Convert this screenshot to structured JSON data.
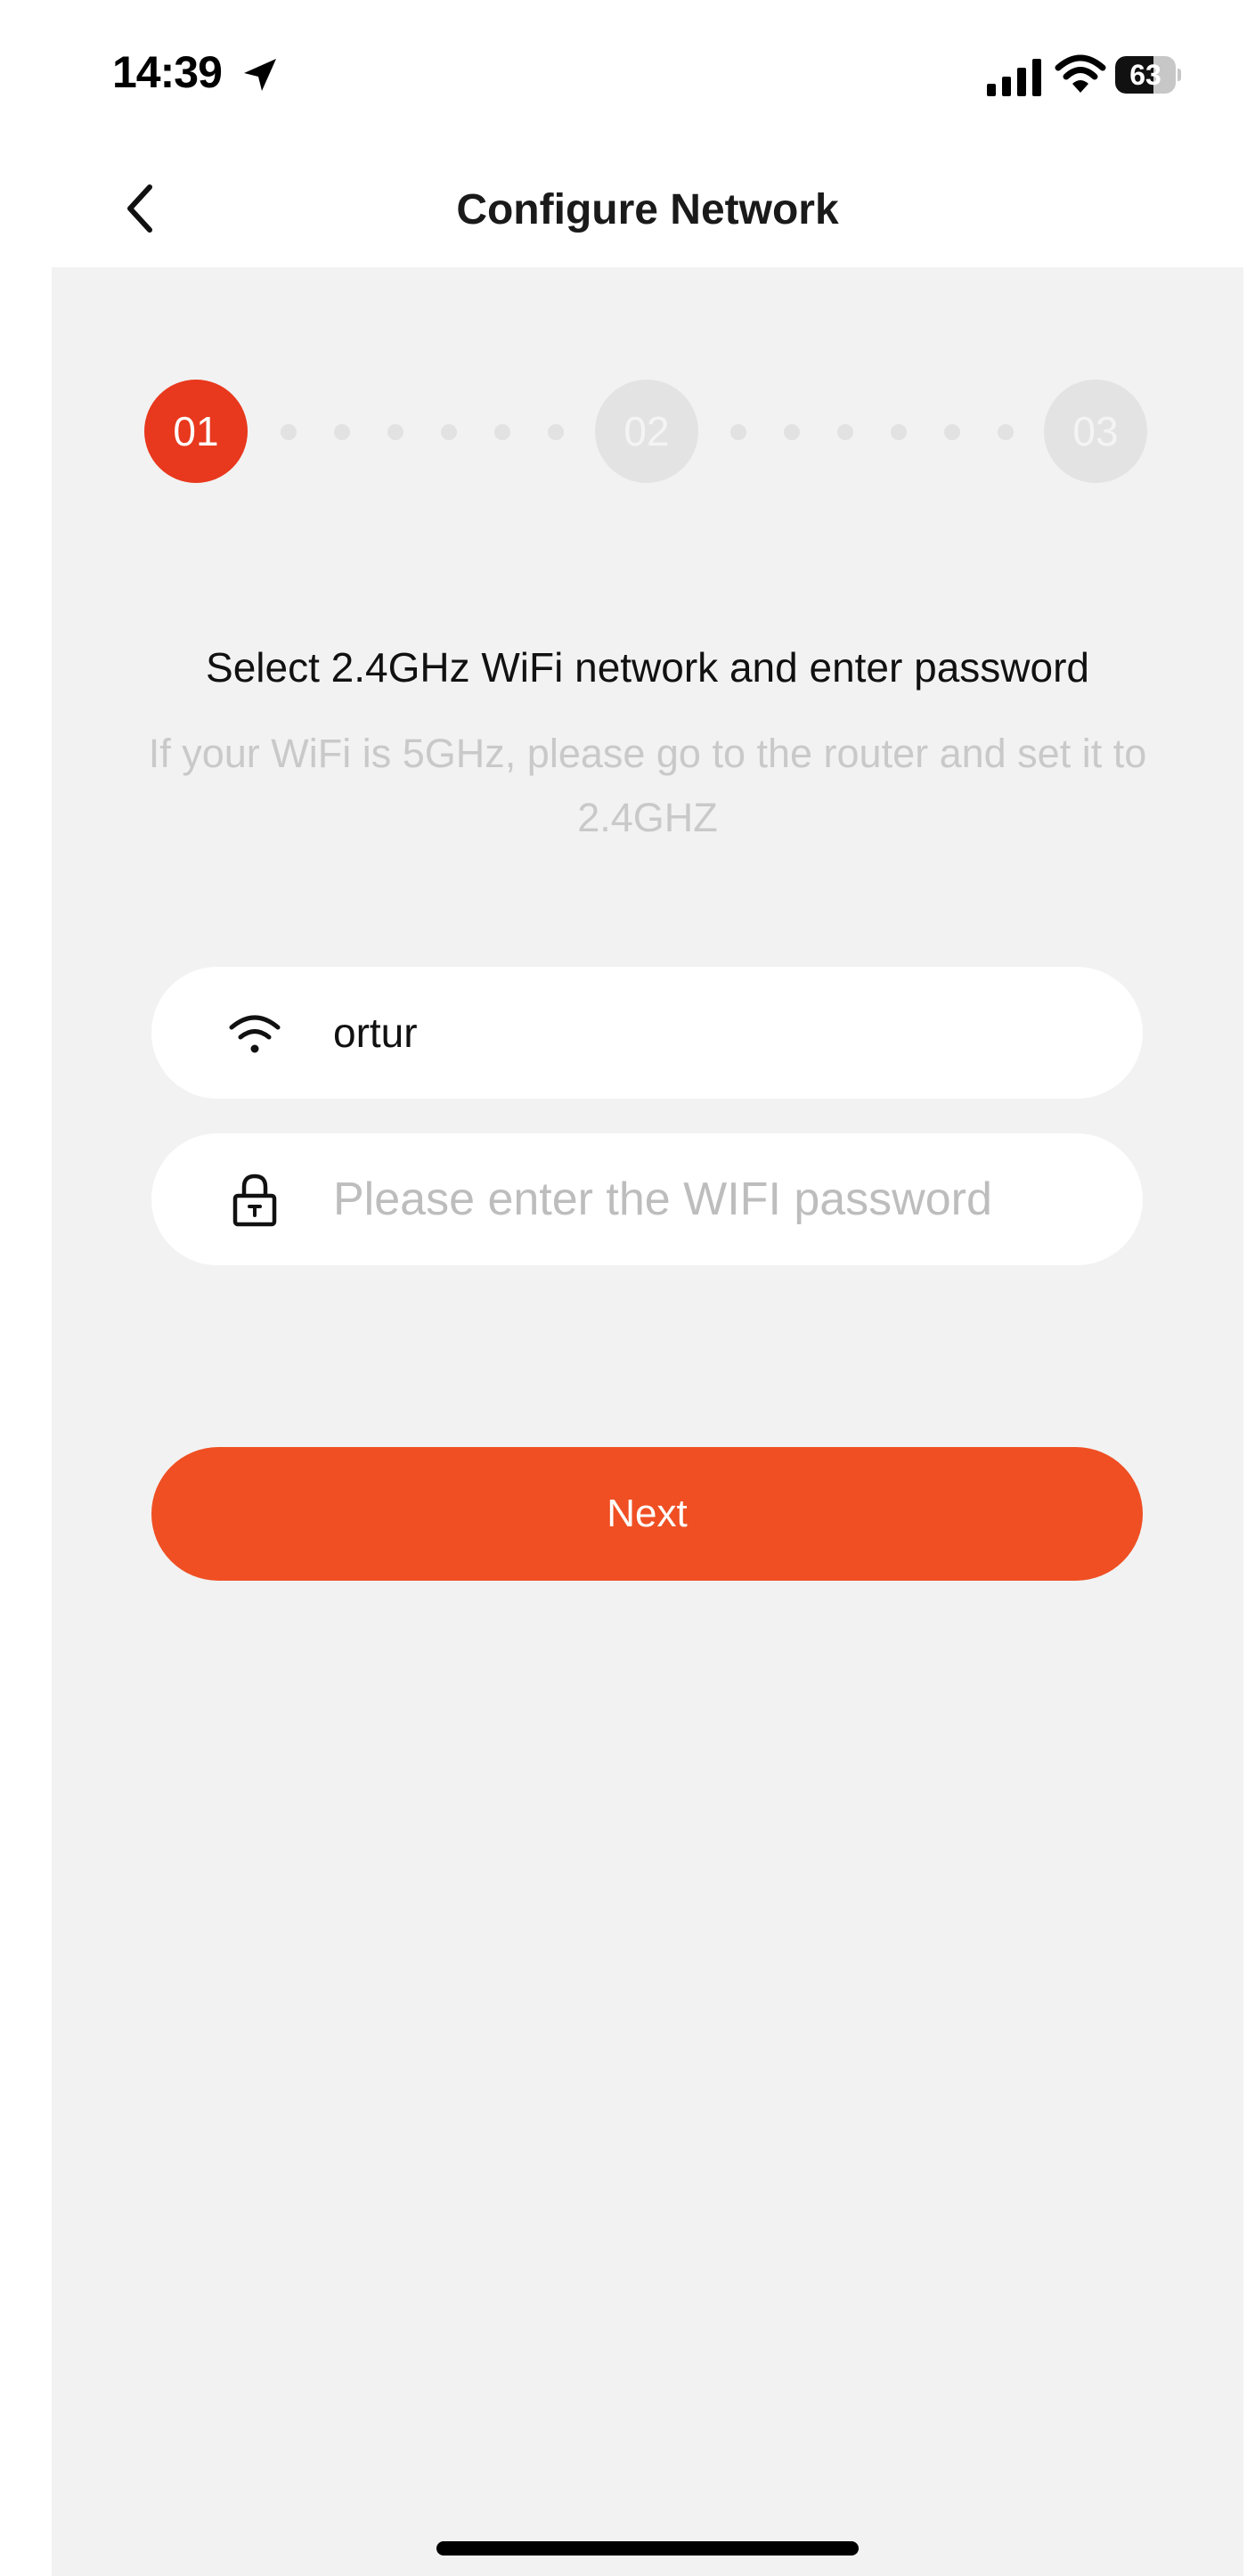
{
  "status_bar": {
    "time": "14:39",
    "battery_level": 63,
    "battery_text": "63",
    "icons": [
      "location-arrow-icon",
      "cellular-signal-icon",
      "wifi-icon",
      "battery-icon"
    ]
  },
  "nav": {
    "title": "Configure Network",
    "back_icon": "chevron-left-icon"
  },
  "stepper": {
    "current_step": 1,
    "steps": [
      {
        "label": "01",
        "active": true
      },
      {
        "label": "02",
        "active": false
      },
      {
        "label": "03",
        "active": false
      }
    ]
  },
  "instructions": {
    "heading": "Select 2.4GHz WiFi network and enter password",
    "subheading": "If your WiFi is 5GHz, please go to the router and set it to 2.4GHZ"
  },
  "form": {
    "network_name": "ortur",
    "network_icon": "wifi-icon",
    "password_value": "",
    "password_placeholder": "Please enter the WIFI password",
    "password_icon": "lock-icon"
  },
  "actions": {
    "next_label": "Next"
  },
  "colors": {
    "accent": "#ef4f23",
    "step_active": "#e8381d",
    "step_inactive": "#e3e3e3",
    "background": "#f2f2f2",
    "placeholder": "#bdbdbd",
    "subtext": "#c9c9c9"
  }
}
